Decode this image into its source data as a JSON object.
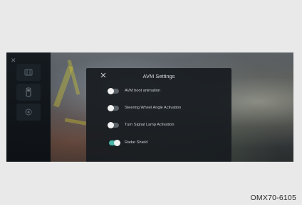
{
  "sidebar": {
    "icons": [
      "close-icon",
      "parking-icon",
      "car-view-icon",
      "camera-settings-icon"
    ]
  },
  "dialog": {
    "title": "AVM Settings",
    "close_icon": "close-icon",
    "options": [
      {
        "label": "AVM boot animation",
        "state": "off"
      },
      {
        "label": "Steering Wheel Angle Activation",
        "state": "off"
      },
      {
        "label": "Turn Signal Lamp Activation",
        "state": "off"
      },
      {
        "label": "Radar Shield",
        "state": "on"
      }
    ]
  },
  "colors": {
    "toggle_on": "#49b4a8",
    "toggle_off": "#5b6268",
    "dialog_bg": "#181c20"
  },
  "figure_caption": "OMX70-6105"
}
